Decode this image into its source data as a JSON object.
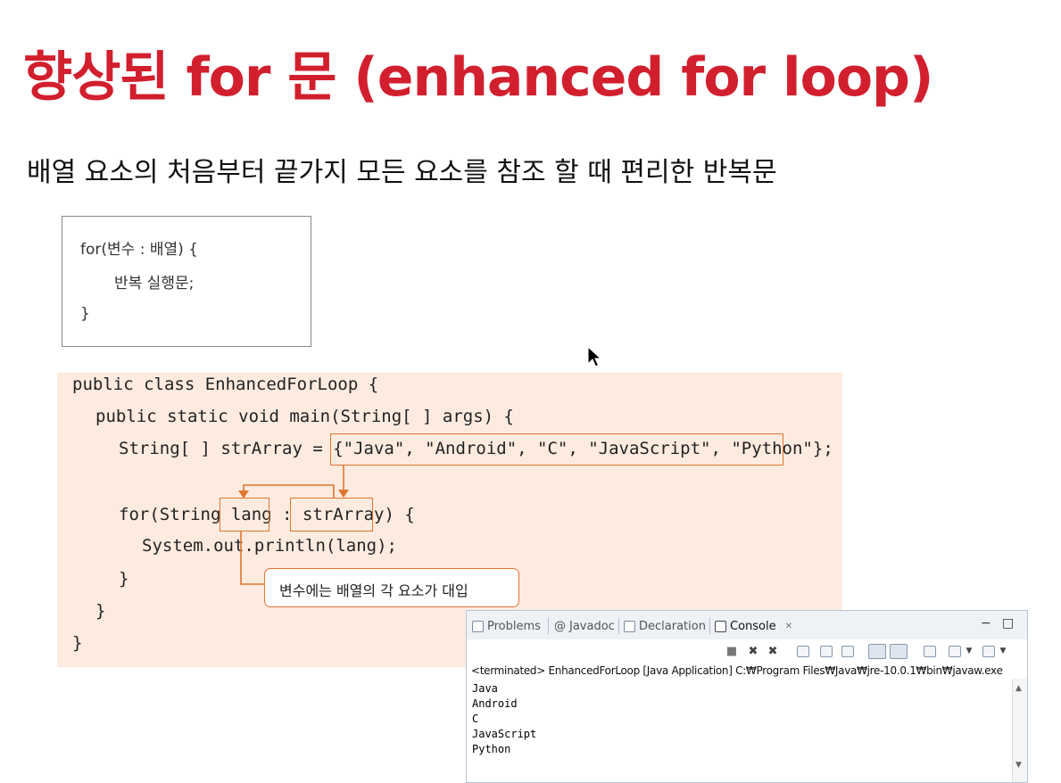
{
  "slide": {
    "title": "향상된 for 문 (enhanced for loop)",
    "subtitle": "배열 요소의 처음부터 끝가지 모든 요소를 참조 할 때 편리한 반복문"
  },
  "syntax": {
    "line1": "for(변수 : 배열) {",
    "line2": "반복 실행문;",
    "line3": "}"
  },
  "code": {
    "line1": "public class EnhancedForLoop {",
    "line2": "public static void main(String[ ] args) {",
    "line3_prefix": "String[ ] strArray = {",
    "line3_array": "\"Java\", \"Android\", \"C\", \"JavaScript\", \"Python\"",
    "line3_suffix": "};",
    "line4_prefix": "for(String ",
    "line4_var": "lang",
    "line4_colon": " : ",
    "line4_array": "strArray",
    "line4_suffix": ") {",
    "line5": "System.out.println(lang);",
    "line6": "}",
    "line7": "}",
    "line8": "}"
  },
  "callout": {
    "text": "변수에는 배열의 각 요소가 대입"
  },
  "console": {
    "tabs": [
      {
        "label": "Problems",
        "icon": "problems-icon"
      },
      {
        "label": "Javadoc",
        "icon": "javadoc-icon"
      },
      {
        "label": "Declaration",
        "icon": "declaration-icon"
      },
      {
        "label": "Console",
        "icon": "console-icon",
        "active": true
      }
    ],
    "close_glyph": "✕",
    "minimize_glyph": "−",
    "maximize_glyph": "□",
    "status": "<terminated> EnhancedForLoop [Java Application] C:₩Program Files₩Java₩jre-10.0.1₩bin₩javaw.exe",
    "output": [
      "Java",
      "Android",
      "C",
      "JavaScript",
      "Python"
    ]
  },
  "colors": {
    "title": "#d21f2e",
    "highlight": "#e0762f",
    "code_bg": "#fdebdf"
  }
}
